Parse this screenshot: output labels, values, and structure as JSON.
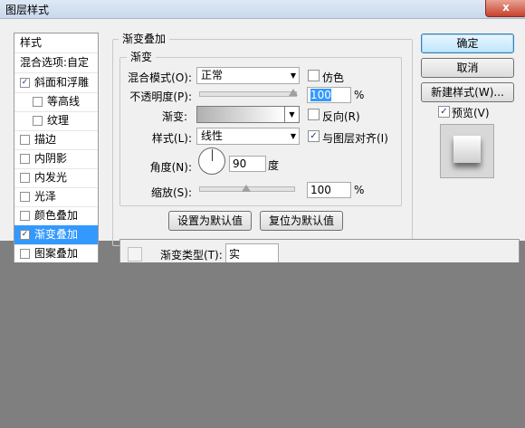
{
  "window": {
    "title": "图层样式",
    "close_glyph": "x"
  },
  "style_list": {
    "header": "样式",
    "blend_options": "混合选项:自定",
    "items": [
      {
        "label": "斜面和浮雕",
        "checked": true,
        "check_glyph": "✓",
        "indent": false,
        "selected": false
      },
      {
        "label": "等高线",
        "checked": false,
        "check_glyph": "",
        "indent": true,
        "selected": false
      },
      {
        "label": "纹理",
        "checked": false,
        "check_glyph": "",
        "indent": true,
        "selected": false
      },
      {
        "label": "描边",
        "checked": false,
        "check_glyph": "",
        "indent": false,
        "selected": false
      },
      {
        "label": "内阴影",
        "checked": false,
        "check_glyph": "",
        "indent": false,
        "selected": false
      },
      {
        "label": "内发光",
        "checked": false,
        "check_glyph": "",
        "indent": false,
        "selected": false
      },
      {
        "label": "光泽",
        "checked": false,
        "check_glyph": "",
        "indent": false,
        "selected": false
      },
      {
        "label": "颜色叠加",
        "checked": false,
        "check_glyph": "",
        "indent": false,
        "selected": false
      },
      {
        "label": "渐变叠加",
        "checked": true,
        "check_glyph": "✓",
        "indent": false,
        "selected": true
      },
      {
        "label": "图案叠加",
        "checked": false,
        "check_glyph": "",
        "indent": false,
        "selected": false
      }
    ]
  },
  "gradient_overlay": {
    "section_title": "渐变叠加",
    "subsection_title": "渐变",
    "blend_mode_label": "混合模式(O):",
    "blend_mode_value": "正常",
    "dither_label": "仿色",
    "opacity_label": "不透明度(P):",
    "opacity_value": "100",
    "opacity_level": 1.0,
    "percent": "%",
    "gradient_label": "渐变:",
    "reverse_label": "反向(R)",
    "style_label": "样式(L):",
    "style_value": "线性",
    "align_label": "与图层对齐(I)",
    "align_checked_glyph": "✓",
    "angle_label": "角度(N):",
    "angle_value": "90",
    "angle_unit": "度",
    "scale_label": "缩放(S):",
    "scale_value": "100",
    "scale_level": 0.5,
    "set_default_button": "设置为默认值",
    "reset_default_button": "复位为默认值"
  },
  "buttons": {
    "ok": "确定",
    "cancel": "取消",
    "new_style": "新建样式(W)...",
    "preview_label": "预览(V)",
    "preview_glyph": "✓"
  },
  "gradient_editor": {
    "type_label": "渐变类型(T):",
    "type_value": "实"
  },
  "colors": {
    "selection": "#3399ff",
    "dialog_bg": "#f0f0f0",
    "overlay": "#7f7f7f"
  }
}
